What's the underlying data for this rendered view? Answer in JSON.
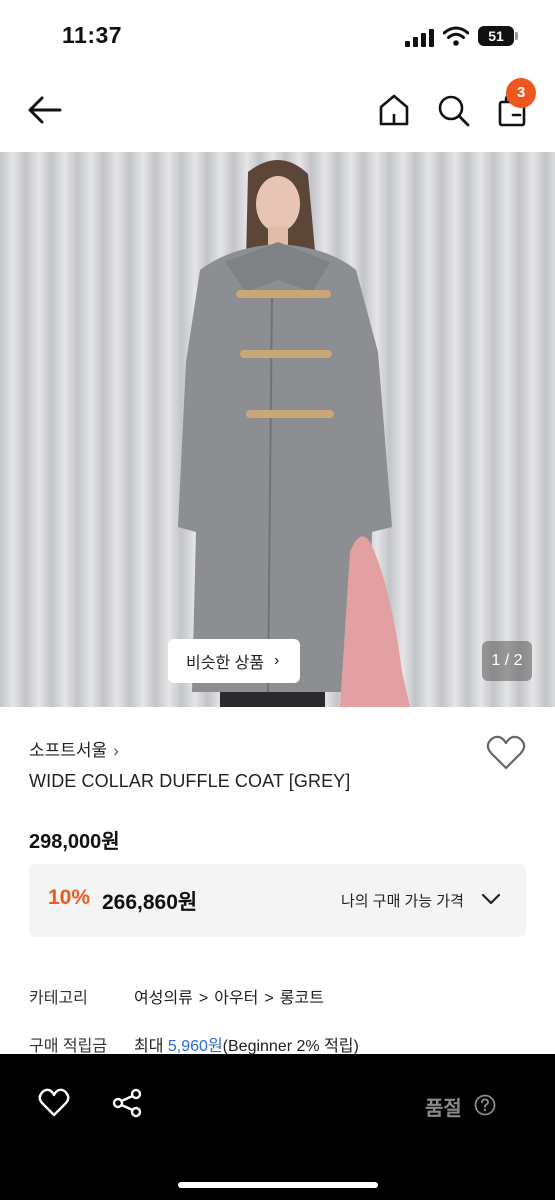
{
  "status_bar": {
    "time": "11:37",
    "battery": "51"
  },
  "nav": {
    "cart_count": "3"
  },
  "gallery": {
    "similar_label": "비슷한 상품",
    "page_indicator": "1 / 2"
  },
  "product": {
    "brand": "소프트서울",
    "name": "WIDE COLLAR DUFFLE COAT [GREY]",
    "price": "298,000원",
    "discount_rate": "10%",
    "discount_price": "266,860원",
    "my_price_label": "나의 구매 가능 가격"
  },
  "info": {
    "category_label": "카테고리",
    "category_path": [
      "여성의류",
      "아우터",
      "롱코트"
    ],
    "points_label": "구매 적립금",
    "points_prefix": "최대",
    "points_amount": "5,960원",
    "points_suffix": "(Beginner 2% 적립)"
  },
  "bottom_bar": {
    "status": "품절"
  },
  "colors": {
    "accent": "#ef5a1d",
    "badge": "#f0571f",
    "link": "#2b6bcf"
  },
  "icons": [
    "back-arrow-icon",
    "home-icon",
    "search-icon",
    "shopping-bag-icon",
    "heart-icon",
    "share-icon",
    "question-icon",
    "chevron-right-icon",
    "chevron-down-icon"
  ]
}
